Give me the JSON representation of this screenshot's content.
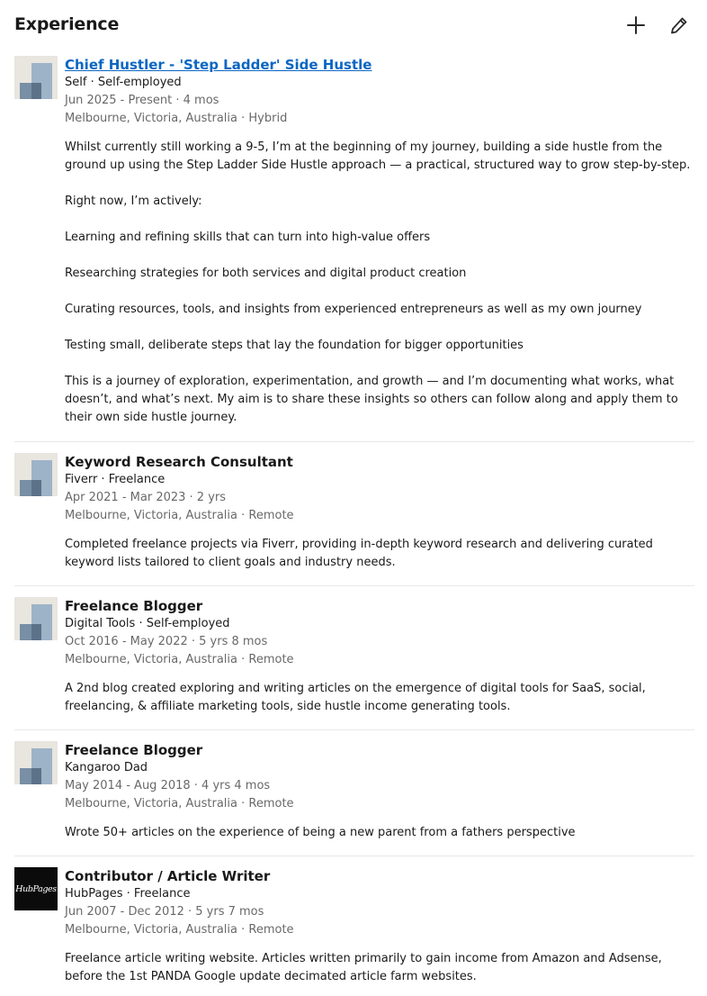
{
  "section": {
    "title": "Experience",
    "add_icon": "plus-icon",
    "edit_icon": "pencil-icon"
  },
  "entries": [
    {
      "logo": "company-logo-placeholder",
      "title": "Chief Hustler - 'Step Ladder' Side Hustle ",
      "company": "Self · Self-employed",
      "dates": "Jun 2025 - Present · 4 mos",
      "location": "Melbourne, Victoria, Australia · Hybrid",
      "description": [
        "Whilst currently still working a 9-5, I’m at the beginning of my journey, building a side hustle from the ground up using the Step Ladder Side Hustle approach — a practical, structured way to grow step-by-step.",
        "Right now, I’m actively:",
        "Learning and refining skills that can turn into high-value offers",
        "Researching strategies for both services and digital product creation",
        "Curating resources, tools, and insights from experienced entrepreneurs as well as my own journey",
        "Testing small, deliberate steps that lay the foundation for bigger opportunities",
        "This is a journey of exploration, experimentation, and growth — and I’m documenting what works, what doesn’t, and what’s next. My aim is to share these insights so others can follow along and apply them to their own side hustle journey."
      ]
    },
    {
      "logo": "company-logo-placeholder",
      "title": "Keyword Research Consultant",
      "company": "Fiverr · Freelance",
      "dates": "Apr 2021 - Mar 2023 · 2 yrs",
      "location": "Melbourne, Victoria, Australia · Remote",
      "description": [
        "Completed freelance projects via Fiverr, providing in-depth keyword research and delivering curated keyword lists tailored to client goals and industry needs."
      ]
    },
    {
      "logo": "company-logo-placeholder",
      "title": "Freelance Blogger",
      "company": "Digital Tools · Self-employed",
      "dates": "Oct 2016 - May 2022 · 5 yrs 8 mos",
      "location": "Melbourne, Victoria, Australia · Remote",
      "description": [
        "A 2nd blog created exploring and writing articles on the emergence of digital tools for SaaS, social, freelancing, & affiliate marketing tools, side hustle income generating tools."
      ]
    },
    {
      "logo": "company-logo-placeholder",
      "title": "Freelance Blogger",
      "company": "Kangaroo Dad",
      "dates": "May 2014 - Aug 2018 · 4 yrs 4 mos",
      "location": "Melbourne, Victoria, Australia · Remote",
      "description": [
        "Wrote 50+ articles on the experience of being a new parent from a fathers perspective"
      ]
    },
    {
      "logo": "hubpages-logo",
      "logo_text": "HubPages",
      "title": "Contributor / Article Writer",
      "company": "HubPages · Freelance",
      "dates": "Jun 2007 - Dec 2012 · 5 yrs 7 mos",
      "location": "Melbourne, Victoria, Australia · Remote",
      "description": [
        "Freelance article writing website. Articles written primarily to gain income from Amazon and Adsense, before the 1st PANDA Google update decimated article farm websites."
      ]
    }
  ]
}
